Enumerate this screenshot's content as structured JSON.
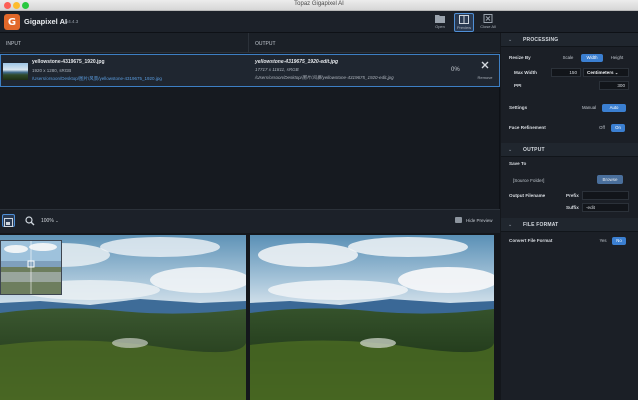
{
  "window": {
    "title": "Topaz Gigapixel AI"
  },
  "header": {
    "app_name": "Gigapixel AI",
    "version": "v4.4.3",
    "buttons": {
      "open": "Open",
      "preview": "Preview",
      "close_all": "Close All"
    }
  },
  "queue": {
    "input_header": "INPUT",
    "output_header": "OUTPUT",
    "row": {
      "input_name": "yellowstone-4319675_1920.jpg",
      "input_meta": "1920 x 1280, sRGB",
      "input_path": "/Users/orsoon/Desktop/图片/风景/yellowstone-4319675_1920.jpg",
      "output_name": "yellowstone-4319675_1920-edit.jpg",
      "output_meta": "17717 x 11811, sRGB",
      "output_path": "/Users/orsoon/Desktop/图片/风景/yellowstone-4319675_1920-edit.jpg",
      "progress": "0%",
      "remove": "Remove"
    }
  },
  "preview_toolbar": {
    "zoom": "100%",
    "hide_preview": "Hide Preview"
  },
  "panel": {
    "processing": {
      "title": "PROCESSING",
      "resize_by": "Resize By",
      "resize_options": [
        "Scale",
        "Width",
        "Height"
      ],
      "resize_selected": "Width",
      "max_width_label": "Max Width",
      "max_width_value": "150",
      "unit": "Centimeters",
      "ppi_label": "PPI",
      "ppi_value": "300",
      "settings_label": "Settings",
      "settings_options": [
        "Manual",
        "Auto"
      ],
      "settings_selected": "Auto",
      "face_label": "Face Refinement",
      "face_options": [
        "Off",
        "On"
      ],
      "face_selected": "On"
    },
    "output": {
      "title": "OUTPUT",
      "save_to": "Save To",
      "folder": "[Source Folder]",
      "browse": "Browse",
      "filename_label": "Output Filename",
      "prefix_label": "Prefix",
      "prefix_value": "",
      "suffix_label": "Suffix",
      "suffix_value": "-edit"
    },
    "file_format": {
      "title": "FILE FORMAT",
      "convert_label": "Convert File Format",
      "options": [
        "Yes",
        "No"
      ],
      "selected": "No"
    }
  },
  "colors": {
    "accent": "#3b7fd1",
    "logo": "#e2682a",
    "background": "#14171c"
  }
}
